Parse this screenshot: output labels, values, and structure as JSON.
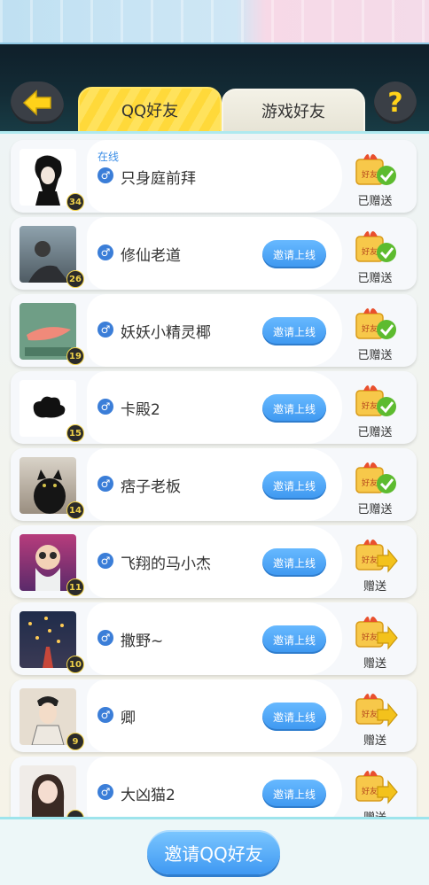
{
  "header": {
    "tabs": [
      {
        "label": "QQ好友",
        "active": true
      },
      {
        "label": "游戏好友",
        "active": false
      }
    ],
    "help_label": "?"
  },
  "friends": [
    {
      "name": "只身庭前拜",
      "level": "34",
      "status": "在线",
      "gift": "已赠送",
      "gift_state": "sent",
      "invite": ""
    },
    {
      "name": "修仙老道",
      "level": "26",
      "status": "",
      "gift": "已赠送",
      "gift_state": "sent",
      "invite": "邀请上线"
    },
    {
      "name": "妖妖小精灵椰",
      "level": "19",
      "status": "",
      "gift": "已赠送",
      "gift_state": "sent",
      "invite": "邀请上线"
    },
    {
      "name": "卡殿2",
      "level": "15",
      "status": "",
      "gift": "已赠送",
      "gift_state": "sent",
      "invite": "邀请上线"
    },
    {
      "name": "痞子老板",
      "level": "14",
      "status": "",
      "gift": "已赠送",
      "gift_state": "sent",
      "invite": "邀请上线"
    },
    {
      "name": "飞翔的马小杰",
      "level": "11",
      "status": "",
      "gift": "赠送",
      "gift_state": "send",
      "invite": "邀请上线"
    },
    {
      "name": "撒野~",
      "level": "10",
      "status": "",
      "gift": "赠送",
      "gift_state": "send",
      "invite": "邀请上线"
    },
    {
      "name": "卿",
      "level": "9",
      "status": "",
      "gift": "赠送",
      "gift_state": "send",
      "invite": "邀请上线"
    },
    {
      "name": "大凶猫2",
      "level": "",
      "status": "",
      "gift": "赠送",
      "gift_state": "send",
      "invite": "邀请上线"
    }
  ],
  "gift_box_text": "好友",
  "bottom": {
    "invite_label": "邀请QQ好友"
  },
  "colors": {
    "accent": "#3d97f0",
    "tab_active": "#ffd93a",
    "check": "#5dbb2f",
    "arrow": "#f3c21c"
  }
}
